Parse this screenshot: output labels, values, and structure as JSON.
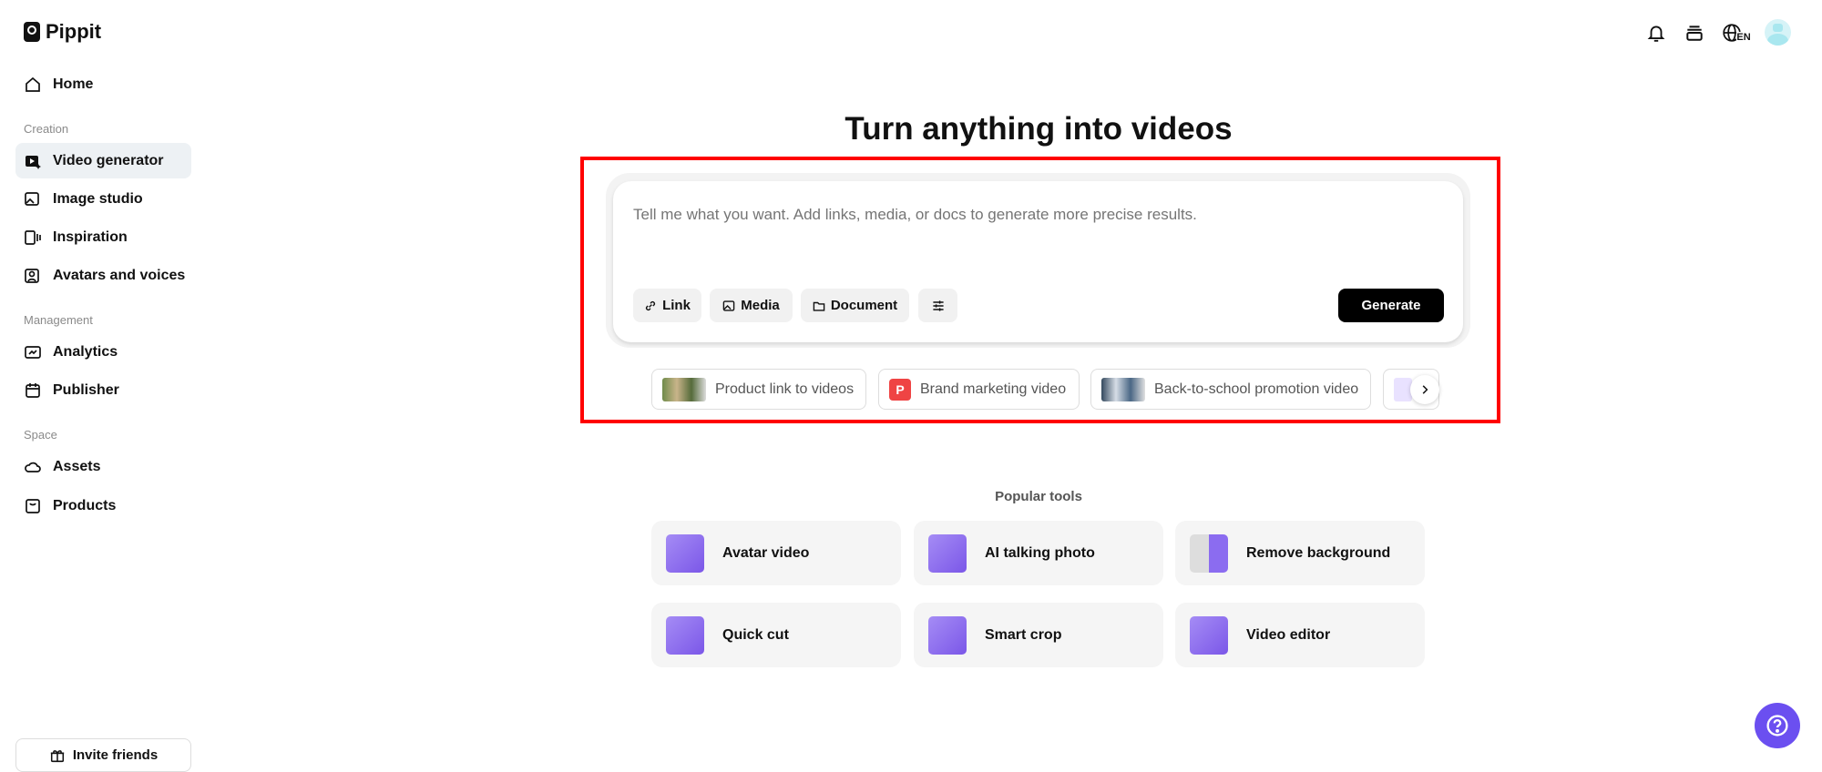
{
  "app": {
    "name": "Pippit"
  },
  "sidebar": {
    "home": "Home",
    "sections": {
      "creation": "Creation",
      "management": "Management",
      "space": "Space"
    },
    "items": [
      {
        "label": "Video generator",
        "icon": "video-sparkle-icon"
      },
      {
        "label": "Image studio",
        "icon": "image-sparkle-icon"
      },
      {
        "label": "Inspiration",
        "icon": "inspiration-icon"
      },
      {
        "label": "Avatars and voices",
        "icon": "avatar-icon"
      },
      {
        "label": "Analytics",
        "icon": "analytics-icon"
      },
      {
        "label": "Publisher",
        "icon": "calendar-icon"
      },
      {
        "label": "Assets",
        "icon": "cloud-icon"
      },
      {
        "label": "Products",
        "icon": "bag-icon"
      }
    ],
    "invite": "Invite friends"
  },
  "header": {
    "language": "EN"
  },
  "main": {
    "title": "Turn anything into videos",
    "prompt_placeholder": "Tell me what you want. Add links, media, or docs to generate more precise results.",
    "buttons": {
      "link": "Link",
      "media": "Media",
      "document": "Document",
      "generate": "Generate"
    },
    "chips": [
      "Product link to videos",
      "Brand marketing video",
      "Back-to-school promotion video"
    ],
    "brand_chip_letter": "P",
    "popular_title": "Popular tools",
    "tools": [
      "Avatar video",
      "AI talking photo",
      "Remove background",
      "Quick cut",
      "Smart crop",
      "Video editor"
    ]
  },
  "colors": {
    "accent": "#6b4ff0",
    "highlight": "#edf1f4",
    "annotation": "#ff0000"
  }
}
